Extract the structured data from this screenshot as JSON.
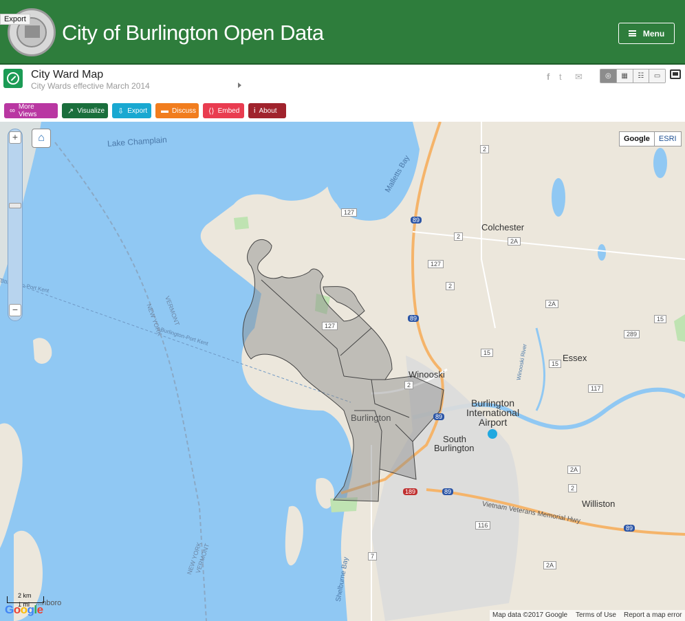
{
  "header": {
    "site_title": "City of Burlington Open Data",
    "menu_label": "Menu",
    "export_tooltip": "Export",
    "bg_color": "#2e7d3c"
  },
  "dataset": {
    "title": "City Ward Map",
    "subtitle": "City Wards effective March 2014",
    "icon": "compass-icon"
  },
  "share": {
    "facebook": "f",
    "twitter": "t",
    "email": "✉"
  },
  "view_modes": [
    {
      "icon": "map-view-icon",
      "glyph": "◎",
      "active": true
    },
    {
      "icon": "grid-view-icon",
      "glyph": "▦",
      "active": false
    },
    {
      "icon": "list-view-icon",
      "glyph": "☷",
      "active": false
    },
    {
      "icon": "page-view-icon",
      "glyph": "▭",
      "active": false
    }
  ],
  "actions": [
    {
      "label": "More Views",
      "color": "#b937a2",
      "icon": "binoculars-icon",
      "glyph": "∞"
    },
    {
      "label": "Visualize",
      "color": "#1a6e3c",
      "icon": "chart-icon",
      "glyph": "↗"
    },
    {
      "label": "Export",
      "color": "#19a8d1",
      "icon": "export-icon",
      "glyph": "⇩"
    },
    {
      "label": "Discuss",
      "color": "#f17d1e",
      "icon": "comment-icon",
      "glyph": "▬"
    },
    {
      "label": "Embed",
      "color": "#e93c50",
      "icon": "code-icon",
      "glyph": "⟨⟩"
    },
    {
      "label": "About",
      "color": "#a0232d",
      "icon": "info-icon",
      "glyph": "i"
    }
  ],
  "map": {
    "basemaps": [
      "Google",
      "ESRI"
    ],
    "labels": {
      "lake": "Lake Champlain",
      "bay": "Malletts Bay",
      "colchester": "Colchester",
      "winooski": "Winooski",
      "burlington": "Burlington",
      "airport": "Burlington\nInternational\nAirport",
      "airport_l1": "Burlington",
      "airport_l2": "International",
      "airport_l3": "Airport",
      "south_burlington_l1": "South",
      "south_burlington_l2": "Burlington",
      "essex": "Essex",
      "williston": "Williston",
      "vermont_top": "VERMONT",
      "newyork_top": "NEW YORK",
      "newyork_bottom": "NEW YORK",
      "vermont_bottom": "VERMONT",
      "ferry1": "Burlington-Port Kent",
      "ferry2": "Burlington-Port Kent",
      "highway": "Vietnam Veterans Memorial Hwy",
      "shelburne": "Shelburne Bay",
      "river": "Winooski River",
      "thornboro": "...nboro"
    },
    "shields": [
      "2",
      "127",
      "89",
      "2",
      "2A",
      "127",
      "2",
      "2A",
      "89",
      "127",
      "15",
      "289",
      "15",
      "15",
      "117",
      "2",
      "89",
      "2A",
      "2",
      "189",
      "89",
      "116",
      "2A",
      "7",
      "89"
    ],
    "scale_km": "2 km",
    "scale_mi": "1 mi",
    "google_logo": "Google",
    "attribution": {
      "data": "Map data ©2017 Google",
      "terms": "Terms of Use",
      "report": "Report a map error"
    }
  }
}
